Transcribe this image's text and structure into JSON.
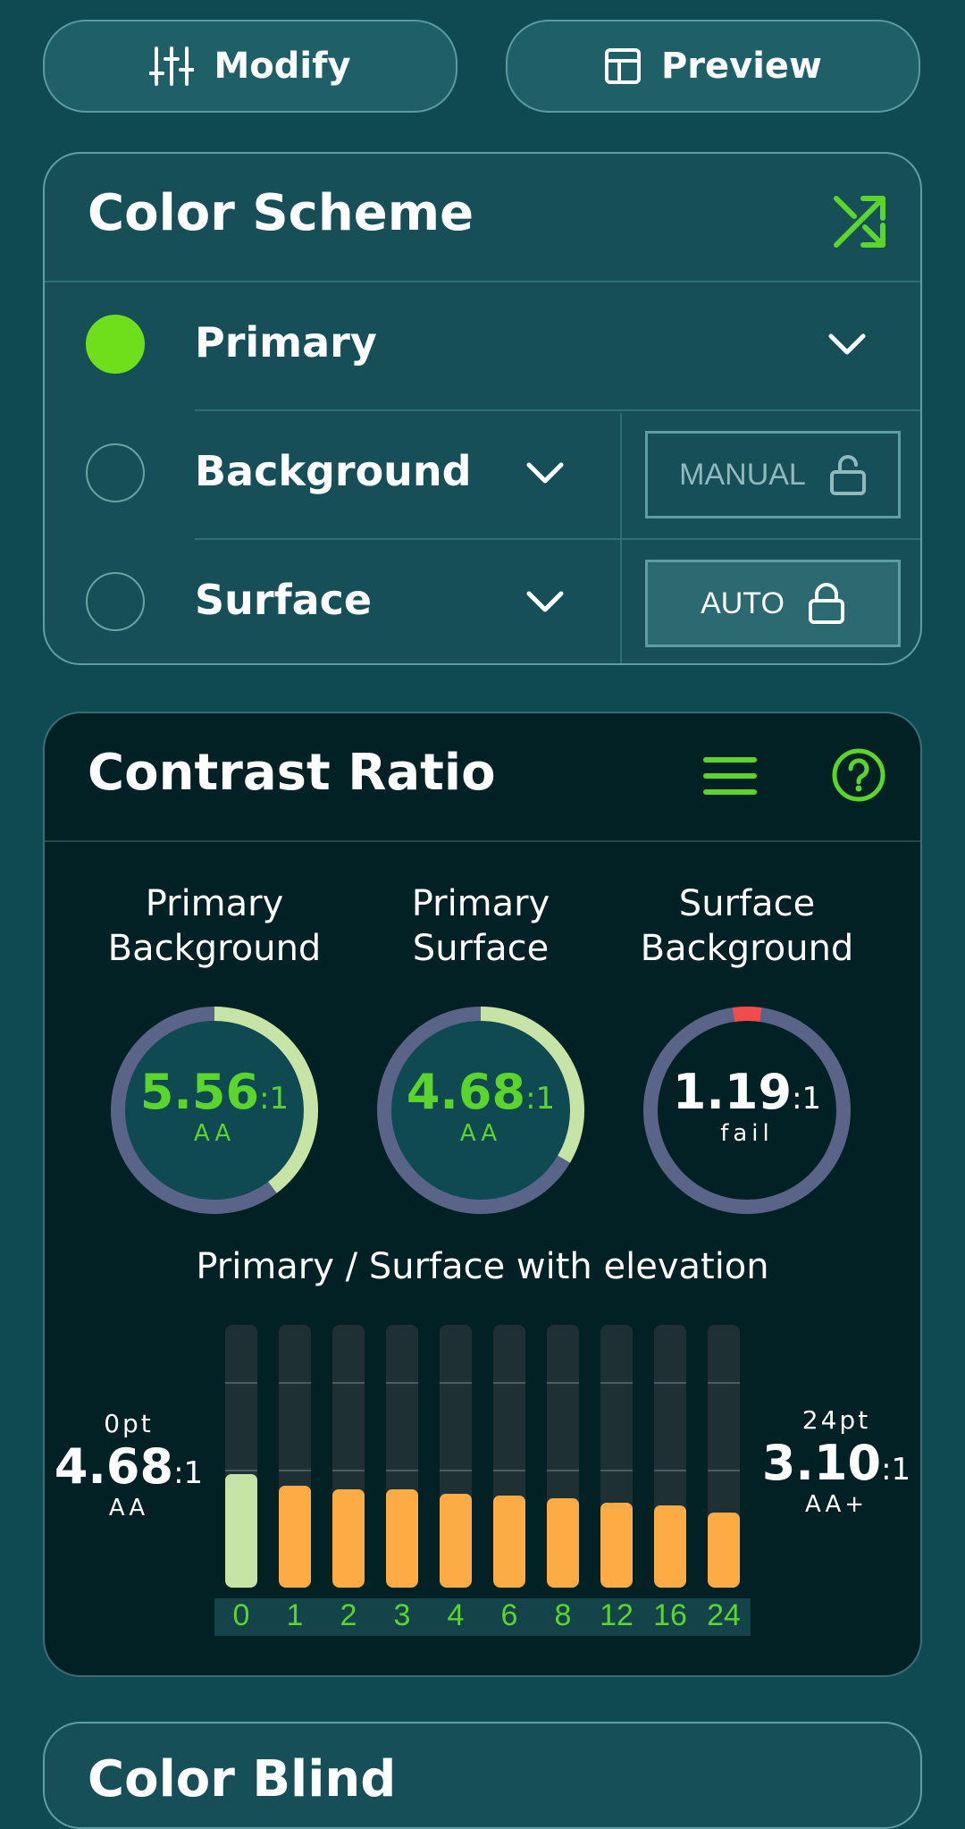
{
  "toolbar": {
    "modify_label": "Modify",
    "preview_label": "Preview"
  },
  "color_scheme": {
    "title": "Color Scheme",
    "rows": [
      {
        "label": "Primary",
        "selected": true,
        "color": "#6ee01b"
      },
      {
        "label": "Background",
        "selected": false,
        "mode": "MANUAL"
      },
      {
        "label": "Surface",
        "selected": false,
        "mode": "AUTO"
      }
    ]
  },
  "contrast": {
    "title": "Contrast Ratio",
    "gauges": [
      {
        "line1": "Primary",
        "line2": "Background",
        "ratio": "5.56",
        "suffix": ":1",
        "grade": "AA",
        "value": 5.56,
        "status": "pass"
      },
      {
        "line1": "Primary",
        "line2": "Surface",
        "ratio": "4.68",
        "suffix": ":1",
        "grade": "AA",
        "value": 4.68,
        "status": "pass"
      },
      {
        "line1": "Surface",
        "line2": "Background",
        "ratio": "1.19",
        "suffix": ":1",
        "grade": "fail",
        "value": 1.19,
        "status": "fail"
      }
    ],
    "elevation_title": "Primary / Surface with elevation",
    "left": {
      "unit": "0pt",
      "ratio": "4.68",
      "suffix": ":1",
      "grade": "AA"
    },
    "right": {
      "unit": "24pt",
      "ratio": "3.10",
      "suffix": ":1",
      "grade": "AA+"
    }
  },
  "chart_data": {
    "type": "bar",
    "categories": [
      "0",
      "1",
      "2",
      "3",
      "4",
      "6",
      "8",
      "12",
      "16",
      "24"
    ],
    "values": [
      4.68,
      4.2,
      4.05,
      4.05,
      3.9,
      3.8,
      3.7,
      3.5,
      3.4,
      3.1
    ],
    "ylim": [
      0,
      10
    ],
    "colors": {
      "first": "#c5e4a6",
      "rest": "#fcab45"
    }
  },
  "footer": {
    "title": "Color Blind"
  }
}
